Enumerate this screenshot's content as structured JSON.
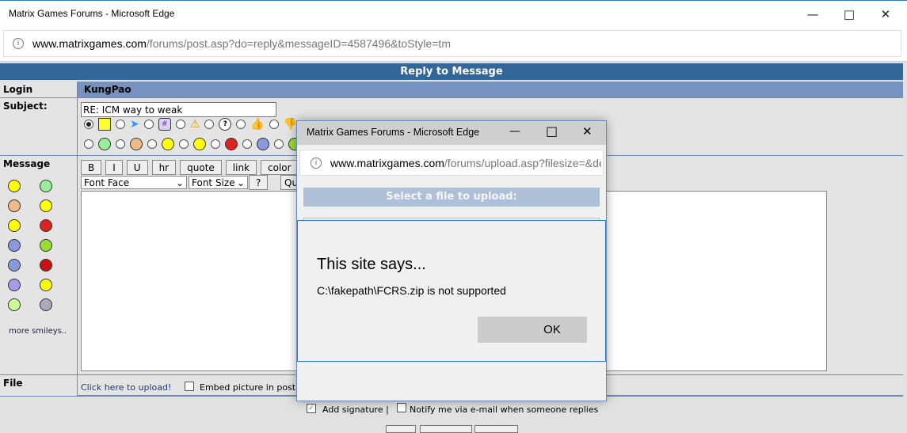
{
  "window": {
    "title": "Matrix Games Forums - Microsoft Edge",
    "url_host": "www.matrixgames.com",
    "url_path": "/forums/post.asp?do=reply&messageID=4587496&toStyle=tm"
  },
  "page": {
    "header": "Reply to Message",
    "login_label": "Login",
    "login_value": "KungPao",
    "subject_label": "Subject:",
    "subject_value": "RE: ICM way to weak",
    "message_label": "Message",
    "more_smileys": "more smileys..",
    "file_label": "File",
    "upload_link": "Click here to upload!",
    "embed_label": "Embed picture in post",
    "add_signature": "Add signature |",
    "notify": "Notify me via e-mail when someone replies"
  },
  "toolbar": {
    "buttons": [
      "B",
      "I",
      "U",
      "hr",
      "quote",
      "link",
      "color"
    ],
    "font_face": "Font Face",
    "font_size": "Font Size",
    "help": "?",
    "quote_short": "Qu"
  },
  "popup": {
    "title": "Matrix Games Forums - Microsoft Edge",
    "url_host": "www.matrixgames.com",
    "url_path": "/forums/upload.asp?filesize=&delete",
    "header": "Select a file to upload:"
  },
  "alert": {
    "title": "This site says...",
    "message": "C:\\fakepath\\FCRS.zip is not supported",
    "ok": "OK"
  }
}
